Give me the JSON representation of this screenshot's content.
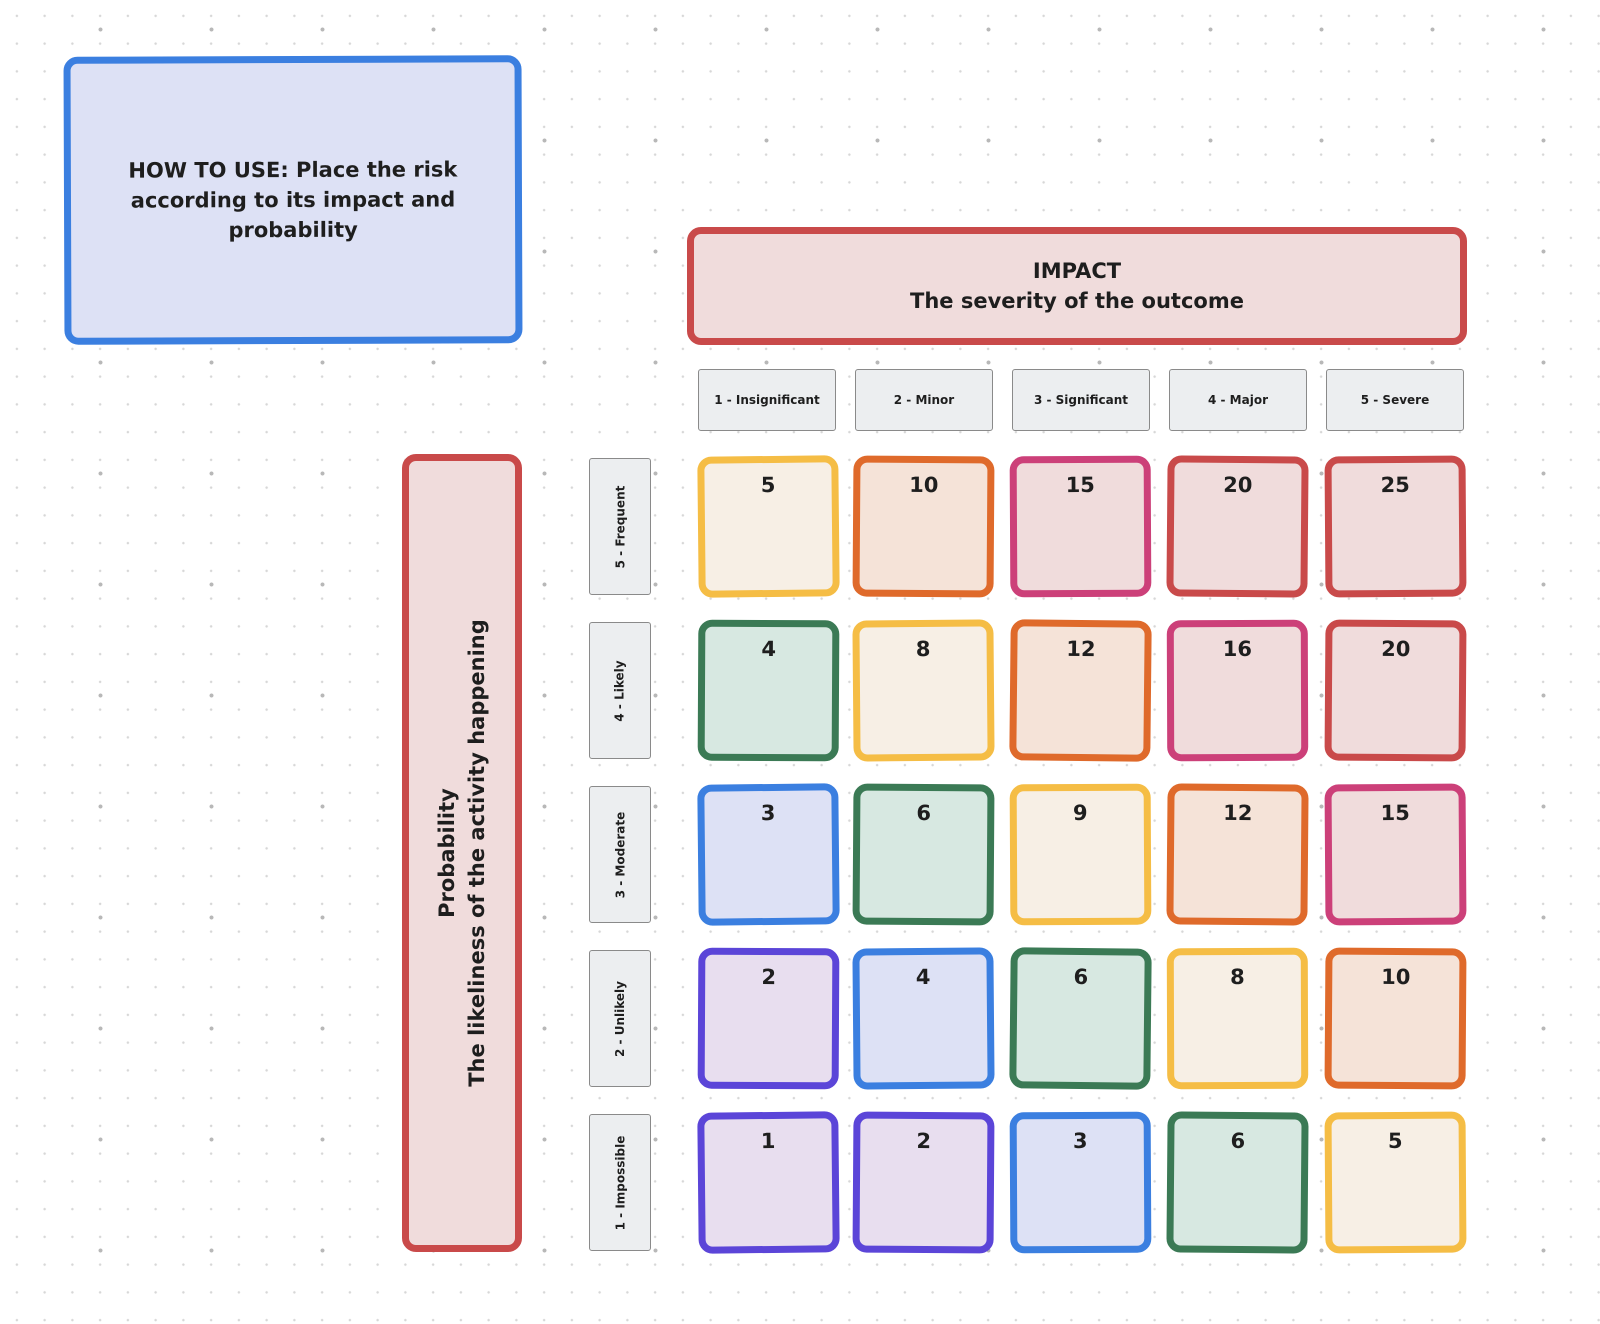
{
  "palette": {
    "yellow": {
      "border": "#f5bd45",
      "fill": "#f7efe5"
    },
    "orange": {
      "border": "#df6a2b",
      "fill": "#f5e3d8"
    },
    "pink": {
      "border": "#cc4079",
      "fill": "#f0dcdc"
    },
    "red": {
      "border": "#c94a4a",
      "fill": "#f0dcdc"
    },
    "green": {
      "border": "#3b7a55",
      "fill": "#d7e8e1"
    },
    "blue": {
      "border": "#3b7fe0",
      "fill": "#dde1f5"
    },
    "purple": {
      "border": "#5b45d8",
      "fill": "#e8deef"
    }
  },
  "howto": {
    "text": "HOW TO USE: Place the risk according to its impact and probability"
  },
  "impact": {
    "title": "IMPACT",
    "subtitle": "The severity of the outcome",
    "levels": [
      "1 - Insignificant",
      "2 - Minor",
      "3 - Significant",
      "4 - Major",
      "5 - Severe"
    ]
  },
  "probability": {
    "title": "Probability",
    "subtitle": "The likeliness of the activity happening",
    "levels": [
      "5 - Frequent",
      "4 - Likely",
      "3 - Moderate",
      "2 - Unlikely",
      "1 - Impossible"
    ]
  },
  "matrix": [
    [
      {
        "value": "5",
        "color": "yellow"
      },
      {
        "value": "10",
        "color": "orange"
      },
      {
        "value": "15",
        "color": "pink"
      },
      {
        "value": "20",
        "color": "red"
      },
      {
        "value": "25",
        "color": "red"
      }
    ],
    [
      {
        "value": "4",
        "color": "green"
      },
      {
        "value": "8",
        "color": "yellow"
      },
      {
        "value": "12",
        "color": "orange"
      },
      {
        "value": "16",
        "color": "pink"
      },
      {
        "value": "20",
        "color": "red"
      }
    ],
    [
      {
        "value": "3",
        "color": "blue"
      },
      {
        "value": "6",
        "color": "green"
      },
      {
        "value": "9",
        "color": "yellow"
      },
      {
        "value": "12",
        "color": "orange"
      },
      {
        "value": "15",
        "color": "pink"
      }
    ],
    [
      {
        "value": "2",
        "color": "purple"
      },
      {
        "value": "4",
        "color": "blue"
      },
      {
        "value": "6",
        "color": "green"
      },
      {
        "value": "8",
        "color": "yellow"
      },
      {
        "value": "10",
        "color": "orange"
      }
    ],
    [
      {
        "value": "1",
        "color": "purple"
      },
      {
        "value": "2",
        "color": "purple"
      },
      {
        "value": "3",
        "color": "blue"
      },
      {
        "value": "6",
        "color": "green"
      },
      {
        "value": "5",
        "color": "yellow"
      }
    ]
  ]
}
